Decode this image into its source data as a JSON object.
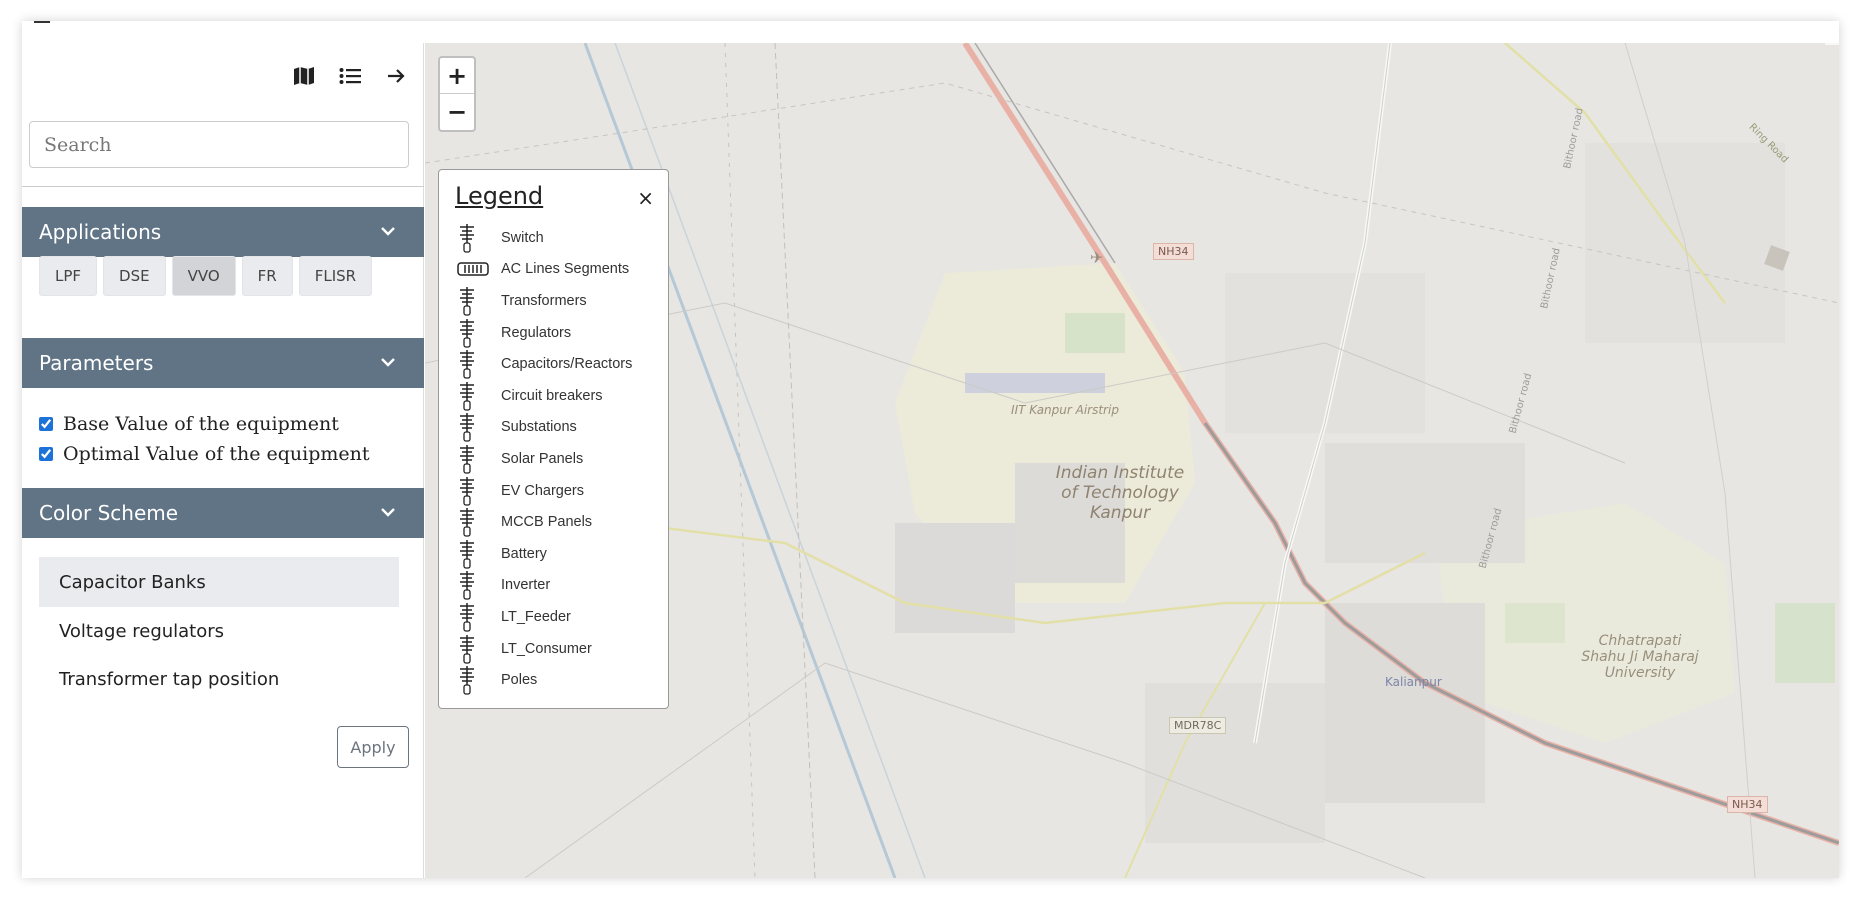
{
  "toolbar": {
    "icons": [
      "map-icon",
      "list-icon",
      "arrow-right-icon"
    ]
  },
  "search": {
    "placeholder": "Search",
    "value": ""
  },
  "applications": {
    "title": "Applications",
    "buttons": [
      "LPF",
      "DSE",
      "VVO",
      "FR",
      "FLISR"
    ],
    "active": "VVO"
  },
  "parameters": {
    "title": "Parameters",
    "items": [
      {
        "label": "Base Value of the equipment",
        "checked": true
      },
      {
        "label": "Optimal Value of the equipment",
        "checked": true
      }
    ]
  },
  "color_scheme": {
    "title": "Color Scheme",
    "items": [
      "Capacitor Banks",
      "Voltage regulators",
      "Transformer tap position"
    ],
    "active": "Capacitor Banks"
  },
  "apply_label": "Apply",
  "zoom": {
    "in": "+",
    "out": "−"
  },
  "legend": {
    "title": "Legend",
    "close": "×",
    "items": [
      "Switch",
      "AC Lines Segments",
      "Transformers",
      "Regulators",
      "Capacitors/Reactors",
      "Circuit breakers",
      "Substations",
      "Solar Panels",
      "EV Chargers",
      "MCCB Panels",
      "Battery",
      "Inverter",
      "LT_Feeder",
      "LT_Consumer",
      "Poles"
    ]
  },
  "map_labels": {
    "airstrip": "IIT Kanpur Airstrip",
    "iit": "Indian Institute of Technology Kanpur",
    "university": "Chhatrapati Shahu Ji Maharaj University",
    "station": "Kalianpur",
    "nh34_a": "NH34",
    "nh34_b": "NH34",
    "mdr": "MDR78C",
    "bithoor_1": "Bithoor road",
    "bithoor_2": "Bithoor road",
    "bithoor_3": "Bithoor road",
    "bithoor_4": "Bithoor road",
    "ring": "Ring Road"
  }
}
